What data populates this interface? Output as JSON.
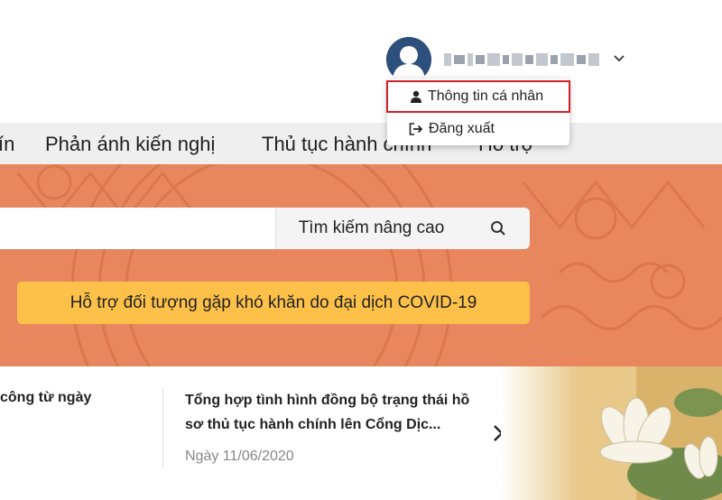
{
  "header": {
    "username": "",
    "account_menu": {
      "items": [
        {
          "label": "Thông tin cá nhân",
          "icon": "user-icon",
          "highlighted": true
        },
        {
          "label": "Đăng xuất",
          "icon": "logout-icon"
        }
      ]
    }
  },
  "nav": {
    "items": [
      {
        "label": "ín"
      },
      {
        "label": "Phản ánh kiến nghị"
      },
      {
        "label": "Thủ tục hành chính"
      },
      {
        "label": "Hỗ trợ"
      }
    ]
  },
  "search": {
    "value": "",
    "advanced_label": "Tìm kiếm nâng cao",
    "button_icon": "search-icon"
  },
  "covid_button": {
    "label": "Hỗ trợ đối tượng gặp khó khăn do đại dịch COVID-19"
  },
  "news": {
    "left_fragment": "công từ ngày",
    "title": "Tổng hợp tình hình đồng bộ trạng thái hồ sơ thủ tục hành chính lên Cổng Dịc...",
    "date": "Ngày 11/06/2020",
    "next_icon": "chevron-right-icon"
  },
  "colors": {
    "hero": "#e8875e",
    "covid_button": "#fdc14a",
    "highlight_border": "#d2202a",
    "avatar": "#2d4f7c"
  }
}
